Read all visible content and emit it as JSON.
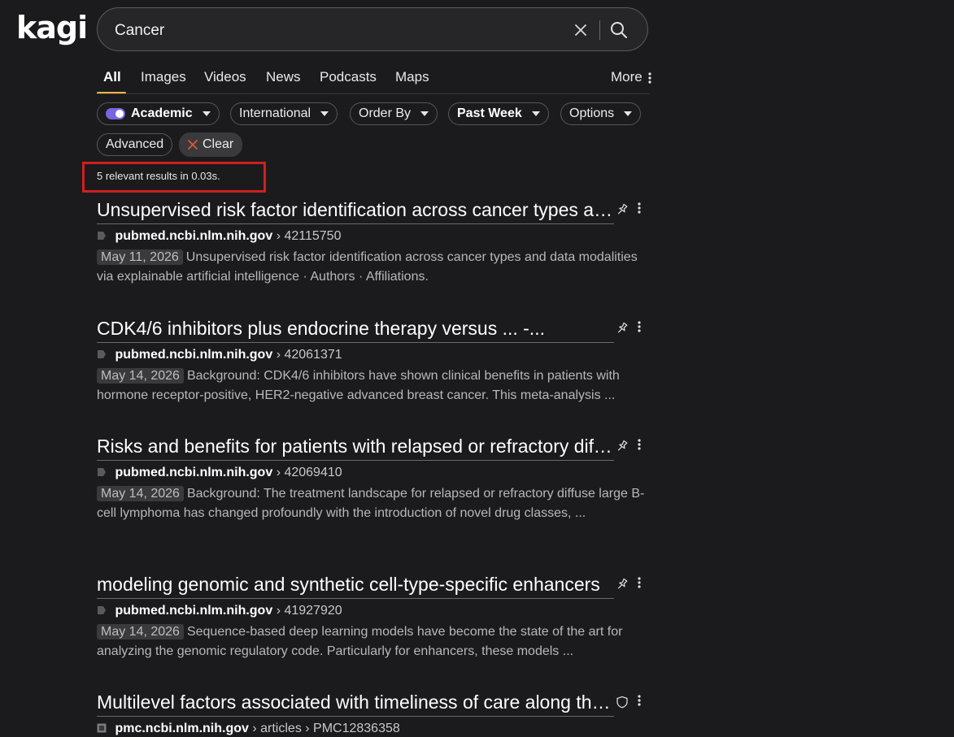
{
  "logo": {
    "text": "kagi"
  },
  "search": {
    "value": "Cancer"
  },
  "tabs": [
    {
      "label": "All"
    },
    {
      "label": "Images"
    },
    {
      "label": "Videos"
    },
    {
      "label": "News"
    },
    {
      "label": "Podcasts"
    },
    {
      "label": "Maps"
    }
  ],
  "more_label": "More",
  "filters": {
    "academic": "Academic",
    "region": "International",
    "order": "Order By",
    "time": "Past Week",
    "options": "Options",
    "advanced": "Advanced",
    "clear": "Clear"
  },
  "result_count": "5 relevant results in 0.03s.",
  "results": [
    {
      "title": "Unsupervised risk factor identification across cancer types and data modalities via explainable artificial intelligence",
      "domain": "pubmed.ncbi.nlm.nih.gov",
      "path": "› 42115750",
      "date": "May 11, 2026",
      "snippet": "Unsupervised risk factor identification across cancer types and data modalities via explainable artificial intelligence · Authors · Affiliations.",
      "action_icon": "pin-icon"
    },
    {
      "title": "CDK4/6 inhibitors plus endocrine therapy versus ... -...",
      "domain": "pubmed.ncbi.nlm.nih.gov",
      "path": "› 42061371",
      "date": "May 14, 2026",
      "snippet": "Background: CDK4/6 inhibitors have shown clinical benefits in patients with hormone receptor-positive, HER2-negative advanced breast cancer. This meta-analysis ...",
      "action_icon": "pin-icon"
    },
    {
      "title": "Risks and benefits for patients with relapsed or refractory diffuse large B-cell lymphoma",
      "domain": "pubmed.ncbi.nlm.nih.gov",
      "path": "› 42069410",
      "date": "May 14, 2026",
      "snippet": "Background: The treatment landscape for relapsed or refractory diffuse large B-cell lymphoma has changed profoundly with the introduction of novel drug classes, ...",
      "action_icon": "pin-icon"
    },
    {
      "title": "modeling genomic and synthetic cell-type-specific enhancers",
      "domain": "pubmed.ncbi.nlm.nih.gov",
      "path": "› 41927920",
      "date": "May 14, 2026",
      "snippet": "Sequence-based deep learning models have become the state of the art for analyzing the genomic regulatory code. Particularly for enhancers, these models ...",
      "action_icon": "pin-icon"
    },
    {
      "title": "Multilevel factors associated with timeliness of care along the cancer care continuum",
      "domain": "pmc.ncbi.nlm.nih.gov",
      "path": "› articles › PMC12836358",
      "date": "",
      "snippet": "",
      "action_icon": "shield-icon"
    }
  ],
  "colors": {
    "background": "#1b1b1d",
    "accent_underline": "#f5b73b",
    "toggle": "#7766e0",
    "highlight_box": "#d11f1f",
    "clear_x": "#e0593a"
  }
}
